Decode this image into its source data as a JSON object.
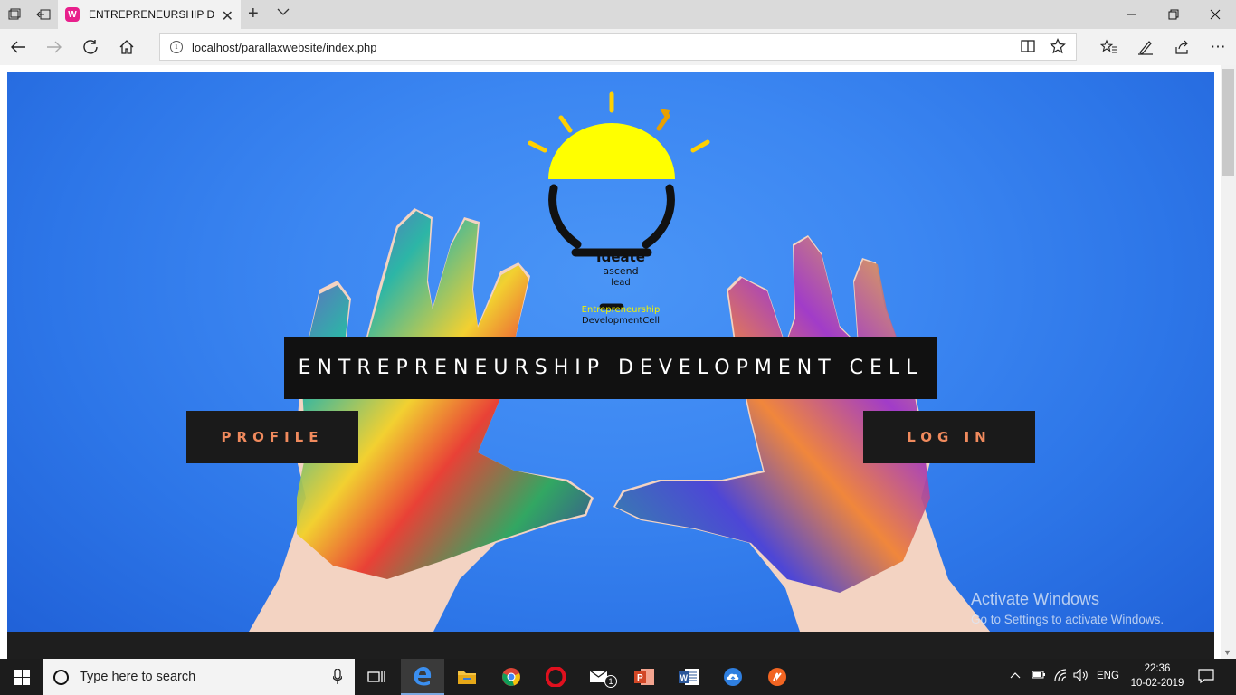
{
  "browser": {
    "tab_title": "ENTREPRENEURSHIP DE",
    "tab_favicon": "W",
    "url": "localhost/parallaxwebsite/index.php"
  },
  "page": {
    "logo": {
      "line1": "Ideate",
      "line2": "ascend",
      "line3": "lead",
      "line4": "Entrepreneurship",
      "line5": "DevelopmentCell"
    },
    "title": "ENTREPRENEURSHIP DEVELOPMENT CELL",
    "profile_label": "PROFILE",
    "login_label": "LOG IN",
    "watermark_title": "Activate Windows",
    "watermark_sub": "Go to Settings to activate Windows."
  },
  "taskbar": {
    "search_placeholder": "Type here to search",
    "mail_badge": "1",
    "language": "ENG",
    "time": "22:36",
    "date": "10-02-2019"
  },
  "colors": {
    "hero_blue": "#3c87f2",
    "button_text": "#f08a5d",
    "bulb_yellow": "#ffff00"
  }
}
